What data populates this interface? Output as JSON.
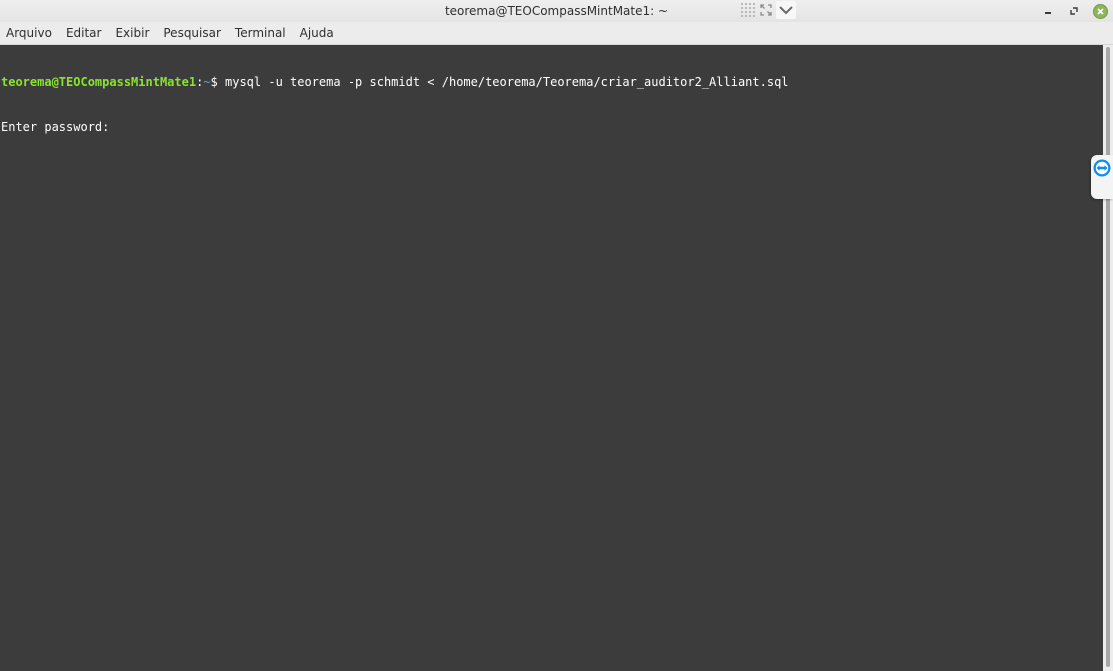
{
  "window": {
    "title": "teorema@TEOCompassMintMate1: ~"
  },
  "menu": {
    "items": [
      {
        "label": "Arquivo"
      },
      {
        "label": "Editar"
      },
      {
        "label": "Exibir"
      },
      {
        "label": "Pesquisar"
      },
      {
        "label": "Terminal"
      },
      {
        "label": "Ajuda"
      }
    ]
  },
  "terminal": {
    "prompt_user_host": "teorema@TEOCompassMintMate1",
    "prompt_separator": ":",
    "prompt_path": "~",
    "prompt_symbol": "$ ",
    "command": "mysql -u teorema -p schmidt < /home/teorema/Teorema/criar_auditor2_Alliant.sql",
    "output_line": "Enter password: "
  },
  "icons": {
    "grid": "grid-icon",
    "expand": "expand-icon",
    "chevron": "chevron-down-icon",
    "minimize": "minimize-icon",
    "maximize": "maximize-icon",
    "close": "close-icon",
    "teamviewer": "teamviewer-icon"
  },
  "colors": {
    "terminal_bg": "#3c3c3c",
    "prompt_user": "#8ae234",
    "prompt_path": "#729fcf",
    "close_button": "#8cb65a",
    "teamviewer": "#0e8ee9"
  }
}
